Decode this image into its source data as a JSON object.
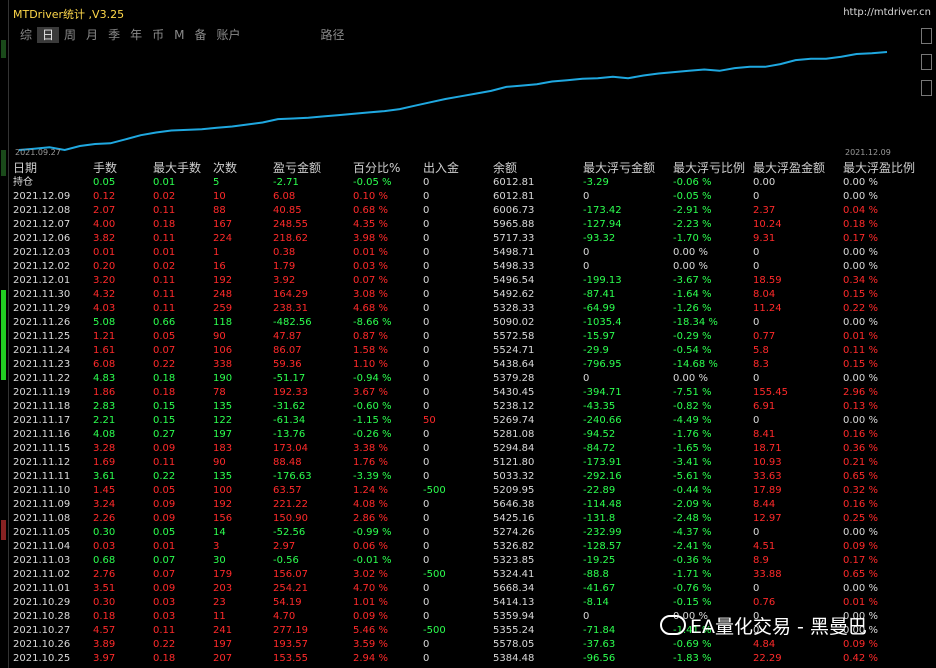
{
  "app": {
    "title": "MTDriver统计 ,V3.25",
    "url": "http://mtdriver.cn"
  },
  "tabs": [
    "综",
    "日",
    "周",
    "月",
    "季",
    "年",
    "币",
    "M",
    "备",
    "账户",
    "路径"
  ],
  "active_tab": "日",
  "chart": {
    "start_label": "2021.09.27",
    "end_label": "2021.12.09",
    "line_color": "#1fa8e0",
    "values": [
      14,
      16,
      18,
      14,
      20,
      23,
      24,
      30,
      36,
      40,
      43,
      44,
      45,
      47,
      49,
      52,
      55,
      60,
      61,
      62,
      64,
      66,
      68,
      70,
      72,
      75,
      80,
      85,
      90,
      94,
      98,
      102,
      108,
      110,
      112,
      116,
      118,
      120,
      121,
      123,
      121,
      125,
      128,
      130,
      132,
      134,
      132,
      136,
      138,
      138,
      142,
      148,
      150,
      150,
      153,
      157,
      158,
      160
    ]
  },
  "headers": [
    "日期",
    "手数",
    "最大手数",
    "次数",
    "盈亏金额",
    "百分比%",
    "出入金",
    "余额",
    "最大浮亏金额",
    "最大浮亏比例",
    "最大浮盈金额",
    "最大浮盈比例"
  ],
  "summary": [
    "持仓",
    "0.05",
    "0.01",
    "5",
    "-2.71",
    "-0.05 %",
    "0",
    "6012.81",
    "-3.29",
    "-0.06 %",
    "0.00",
    "0.00 %"
  ],
  "rows": [
    [
      "2021.12.09",
      "0.12",
      "0.02",
      "10",
      "6.08",
      "0.10 %",
      "0",
      "6012.81",
      "0",
      "-0.05 %",
      "0",
      "0.00 %"
    ],
    [
      "2021.12.08",
      "2.07",
      "0.11",
      "88",
      "40.85",
      "0.68 %",
      "0",
      "6006.73",
      "-173.42",
      "-2.91 %",
      "2.37",
      "0.04 %"
    ],
    [
      "2021.12.07",
      "4.00",
      "0.18",
      "167",
      "248.55",
      "4.35 %",
      "0",
      "5965.88",
      "-127.94",
      "-2.23 %",
      "10.24",
      "0.18 %"
    ],
    [
      "2021.12.06",
      "3.82",
      "0.11",
      "224",
      "218.62",
      "3.98 %",
      "0",
      "5717.33",
      "-93.32",
      "-1.70 %",
      "9.31",
      "0.17 %"
    ],
    [
      "2021.12.03",
      "0.01",
      "0.01",
      "1",
      "0.38",
      "0.01 %",
      "0",
      "5498.71",
      "0",
      "0.00 %",
      "0",
      "0.00 %"
    ],
    [
      "2021.12.02",
      "0.20",
      "0.02",
      "16",
      "1.79",
      "0.03 %",
      "0",
      "5498.33",
      "0",
      "0.00 %",
      "0",
      "0.00 %"
    ],
    [
      "2021.12.01",
      "3.20",
      "0.11",
      "192",
      "3.92",
      "0.07 %",
      "0",
      "5496.54",
      "-199.13",
      "-3.67 %",
      "18.59",
      "0.34 %"
    ],
    [
      "2021.11.30",
      "4.32",
      "0.11",
      "248",
      "164.29",
      "3.08 %",
      "0",
      "5492.62",
      "-87.41",
      "-1.64 %",
      "8.04",
      "0.15 %"
    ],
    [
      "2021.11.29",
      "4.03",
      "0.11",
      "259",
      "238.31",
      "4.68 %",
      "0",
      "5328.33",
      "-64.99",
      "-1.26 %",
      "11.24",
      "0.22 %"
    ],
    [
      "2021.11.26",
      "5.08",
      "0.66",
      "118",
      "-482.56",
      "-8.66 %",
      "0",
      "5090.02",
      "-1035.4",
      "-18.34 %",
      "0",
      "0.00 %"
    ],
    [
      "2021.11.25",
      "1.21",
      "0.05",
      "90",
      "47.87",
      "0.87 %",
      "0",
      "5572.58",
      "-15.97",
      "-0.29 %",
      "0.77",
      "0.01 %"
    ],
    [
      "2021.11.24",
      "1.61",
      "0.07",
      "106",
      "86.07",
      "1.58 %",
      "0",
      "5524.71",
      "-29.9",
      "-0.54 %",
      "5.8",
      "0.11 %"
    ],
    [
      "2021.11.23",
      "6.08",
      "0.22",
      "338",
      "59.36",
      "1.10 %",
      "0",
      "5438.64",
      "-796.95",
      "-14.68 %",
      "8.3",
      "0.15 %"
    ],
    [
      "2021.11.22",
      "4.83",
      "0.18",
      "190",
      "-51.17",
      "-0.94 %",
      "0",
      "5379.28",
      "0",
      "0.00 %",
      "0",
      "0.00 %"
    ],
    [
      "2021.11.19",
      "1.86",
      "0.18",
      "78",
      "192.33",
      "3.67 %",
      "0",
      "5430.45",
      "-394.71",
      "-7.51 %",
      "155.45",
      "2.96 %"
    ],
    [
      "2021.11.18",
      "2.83",
      "0.15",
      "135",
      "-31.62",
      "-0.60 %",
      "0",
      "5238.12",
      "-43.35",
      "-0.82 %",
      "6.91",
      "0.13 %"
    ],
    [
      "2021.11.17",
      "2.21",
      "0.15",
      "122",
      "-61.34",
      "-1.15 %",
      "50",
      "5269.74",
      "-240.66",
      "-4.49 %",
      "0",
      "0.00 %"
    ],
    [
      "2021.11.16",
      "4.08",
      "0.27",
      "197",
      "-13.76",
      "-0.26 %",
      "0",
      "5281.08",
      "-94.52",
      "-1.76 %",
      "8.41",
      "0.16 %"
    ],
    [
      "2021.11.15",
      "3.28",
      "0.09",
      "183",
      "173.04",
      "3.38 %",
      "0",
      "5294.84",
      "-84.72",
      "-1.65 %",
      "18.71",
      "0.36 %"
    ],
    [
      "2021.11.12",
      "1.69",
      "0.11",
      "90",
      "88.48",
      "1.76 %",
      "0",
      "5121.80",
      "-173.91",
      "-3.41 %",
      "10.93",
      "0.21 %"
    ],
    [
      "2021.11.11",
      "3.61",
      "0.22",
      "135",
      "-176.63",
      "-3.39 %",
      "0",
      "5033.32",
      "-292.16",
      "-5.61 %",
      "33.63",
      "0.65 %"
    ],
    [
      "2021.11.10",
      "1.45",
      "0.05",
      "100",
      "63.57",
      "1.24 %",
      "-500",
      "5209.95",
      "-22.89",
      "-0.44 %",
      "17.89",
      "0.32 %"
    ],
    [
      "2021.11.09",
      "3.24",
      "0.09",
      "192",
      "221.22",
      "4.08 %",
      "0",
      "5646.38",
      "-114.48",
      "-2.09 %",
      "8.44",
      "0.16 %"
    ],
    [
      "2021.11.08",
      "2.26",
      "0.09",
      "156",
      "150.90",
      "2.86 %",
      "0",
      "5425.16",
      "-131.8",
      "-2.48 %",
      "12.97",
      "0.25 %"
    ],
    [
      "2021.11.05",
      "0.30",
      "0.05",
      "14",
      "-52.56",
      "-0.99 %",
      "0",
      "5274.26",
      "-232.99",
      "-4.37 %",
      "0",
      "0.00 %"
    ],
    [
      "2021.11.04",
      "0.03",
      "0.01",
      "3",
      "2.97",
      "0.06 %",
      "0",
      "5326.82",
      "-128.57",
      "-2.41 %",
      "4.51",
      "0.09 %"
    ],
    [
      "2021.11.03",
      "0.68",
      "0.07",
      "30",
      "-0.56",
      "-0.01 %",
      "0",
      "5323.85",
      "-19.25",
      "-0.36 %",
      "8.9",
      "0.17 %"
    ],
    [
      "2021.11.02",
      "2.76",
      "0.07",
      "179",
      "156.07",
      "3.02 %",
      "-500",
      "5324.41",
      "-88.8",
      "-1.71 %",
      "33.88",
      "0.65 %"
    ],
    [
      "2021.11.01",
      "3.51",
      "0.09",
      "203",
      "254.21",
      "4.70 %",
      "0",
      "5668.34",
      "-41.67",
      "-0.76 %",
      "0",
      "0.00 %"
    ],
    [
      "2021.10.29",
      "0.30",
      "0.03",
      "23",
      "54.19",
      "1.01 %",
      "0",
      "5414.13",
      "-8.14",
      "-0.15 %",
      "0.76",
      "0.01 %"
    ],
    [
      "2021.10.28",
      "0.18",
      "0.03",
      "11",
      "4.70",
      "0.09 %",
      "0",
      "5359.94",
      "0",
      "0.00 %",
      "0",
      "0.00 %"
    ],
    [
      "2021.10.27",
      "4.57",
      "0.11",
      "241",
      "277.19",
      "5.46 %",
      "-500",
      "5355.24",
      "-71.84",
      "-1.41 %",
      "0",
      "0.00 %"
    ],
    [
      "2021.10.26",
      "3.89",
      "0.22",
      "197",
      "193.57",
      "3.59 %",
      "0",
      "5578.05",
      "-37.63",
      "-0.69 %",
      "4.84",
      "0.09 %"
    ],
    [
      "2021.10.25",
      "3.97",
      "0.18",
      "207",
      "153.55",
      "2.94 %",
      "0",
      "5384.48",
      "-96.56",
      "-1.83 %",
      "22.29",
      "0.42 %"
    ]
  ],
  "colors": {
    "profit": "#ff2a2a",
    "loss": "#2cff4f",
    "title": "#ffd84a"
  },
  "watermark": "EA量化交易 - 黑曼巴"
}
